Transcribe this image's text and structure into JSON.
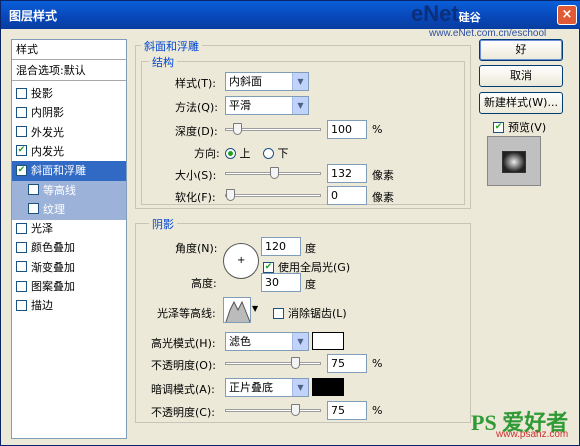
{
  "window": {
    "title": "图层样式",
    "watermark_top": "eNet",
    "watermark_top_cn": "硅谷",
    "watermark_url": "www.eNet.com.cn/eschool"
  },
  "left_panel": {
    "header": "样式",
    "blend_options": "混合选项:默认",
    "items": [
      {
        "label": "投影",
        "checked": false
      },
      {
        "label": "内阴影",
        "checked": false
      },
      {
        "label": "外发光",
        "checked": false
      },
      {
        "label": "内发光",
        "checked": true
      },
      {
        "label": "斜面和浮雕",
        "checked": true
      },
      {
        "label": "等高线",
        "checked": false
      },
      {
        "label": "纹理",
        "checked": false
      },
      {
        "label": "光泽",
        "checked": false
      },
      {
        "label": "颜色叠加",
        "checked": false
      },
      {
        "label": "渐变叠加",
        "checked": false
      },
      {
        "label": "图案叠加",
        "checked": false
      },
      {
        "label": "描边",
        "checked": false
      }
    ]
  },
  "bevel": {
    "section_title": "斜面和浮雕",
    "structure_title": "结构",
    "style_label": "样式(T):",
    "style_value": "内斜面",
    "technique_label": "方法(Q):",
    "technique_value": "平滑",
    "depth_label": "深度(D):",
    "depth_value": "100",
    "depth_unit": "%",
    "depth_level": 0.08,
    "direction_label": "方向:",
    "dir_up": "上",
    "dir_down": "下",
    "size_label": "大小(S):",
    "size_value": "132",
    "size_unit": "像素",
    "size_level": 0.5,
    "soften_label": "软化(F):",
    "soften_value": "0",
    "soften_unit": "像素",
    "soften_level": 0.0
  },
  "shading": {
    "title": "阴影",
    "angle_label": "角度(N):",
    "angle_value": "120",
    "angle_unit": "度",
    "global_light": "使用全局光(G)",
    "altitude_label": "高度:",
    "altitude_value": "30",
    "altitude_unit": "度",
    "gloss_label": "光泽等高线:",
    "anti_alias": "消除锯齿(L)",
    "highlight_mode_label": "高光模式(H):",
    "highlight_mode_value": "滤色",
    "highlight_color": "#ffffff",
    "highlight_opacity_label": "不透明度(O):",
    "highlight_opacity_value": "75",
    "highlight_opacity_level": 0.75,
    "shadow_mode_label": "暗调模式(A):",
    "shadow_mode_value": "正片叠底",
    "shadow_color": "#000000",
    "shadow_opacity_label": "不透明度(C):",
    "shadow_opacity_value": "75",
    "shadow_opacity_level": 0.75,
    "percent": "%"
  },
  "buttons": {
    "ok": "好",
    "cancel": "取消",
    "new_style": "新建样式(W)...",
    "preview": "预览(V)"
  },
  "footer_watermark": {
    "logo": "PS 爱好者",
    "url": "www.psahz.com"
  }
}
